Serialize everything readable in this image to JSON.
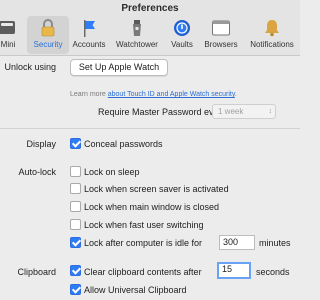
{
  "window": {
    "title": "Preferences"
  },
  "tabs": [
    {
      "label": "Mini",
      "icon": "mini-icon"
    },
    {
      "label": "Security",
      "icon": "lock-icon",
      "active": true
    },
    {
      "label": "Accounts",
      "icon": "flag-icon"
    },
    {
      "label": "Watchtower",
      "icon": "watchtower-icon"
    },
    {
      "label": "Vaults",
      "icon": "vault-icon"
    },
    {
      "label": "Browsers",
      "icon": "browser-icon"
    },
    {
      "label": "Notifications",
      "icon": "bell-icon"
    }
  ],
  "unlock": {
    "label": "Unlock using",
    "button": "Set Up Apple Watch",
    "hint_prefix": "Learn more ",
    "hint_link": "about Touch ID and Apple Watch security",
    "hint_suffix": ".",
    "master_label": "Require Master Password every",
    "master_value": "1 week"
  },
  "display": {
    "label": "Display",
    "conceal": "Conceal passwords",
    "conceal_checked": true
  },
  "autolock": {
    "label": "Auto-lock",
    "options": [
      {
        "label": "Lock on sleep",
        "checked": false
      },
      {
        "label": "Lock when screen saver is activated",
        "checked": false
      },
      {
        "label": "Lock when main window is closed",
        "checked": false
      },
      {
        "label": "Lock when fast user switching",
        "checked": false
      },
      {
        "label": "Lock after computer is idle for",
        "checked": true
      }
    ],
    "idle_value": "300",
    "idle_unit": "minutes"
  },
  "clipboard": {
    "label": "Clipboard",
    "clear_label": "Clear clipboard contents after",
    "clear_checked": true,
    "clear_value": "15",
    "clear_unit": "seconds",
    "universal_label": "Allow Universal Clipboard",
    "universal_checked": true
  },
  "colors": {
    "accent": "#2f7cf6",
    "link": "#2a6fd6"
  }
}
